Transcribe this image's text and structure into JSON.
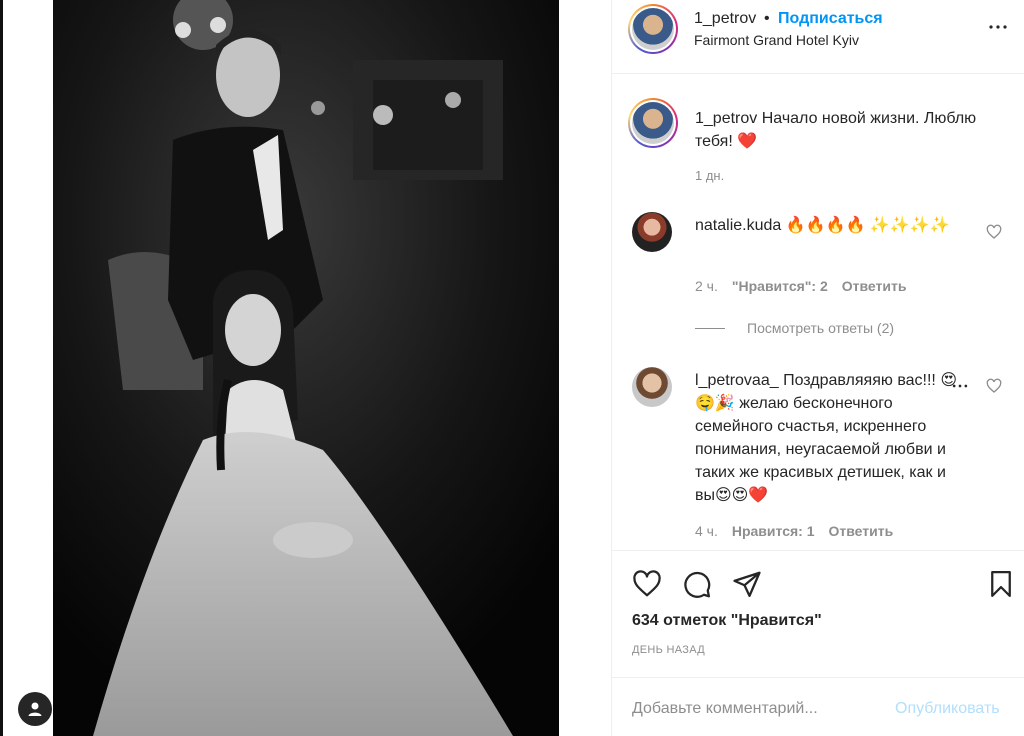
{
  "post": {
    "username": "1_petrov",
    "separator": "•",
    "follow_label": "Подписаться",
    "location": "Fairmont Grand Hotel Kyiv",
    "caption": "Начало новой жизни. Люблю тебя!",
    "caption_emoji": "❤️",
    "caption_time": "1 дн."
  },
  "comments": [
    {
      "username": "natalie.kuda",
      "text": "🔥🔥🔥🔥 ✨✨✨✨",
      "time": "2 ч.",
      "likes": "\"Нравится\": 2",
      "reply": "Ответить"
    },
    {
      "username": "l_petrovaa_",
      "text": "Поздравляяяю вас!!! 😍🤤🎉 желаю бесконечного семейного счастья, искреннего понимания, неугасаемой любви и таких же красивых детишек, как и вы😍😍❤️",
      "time": "4 ч.",
      "likes": "Нравится: 1",
      "reply": "Ответить"
    }
  ],
  "view_replies": "Посмотреть ответы (2)",
  "actions": {
    "like_icon": "heart-icon",
    "comment_icon": "comment-icon",
    "share_icon": "share-icon",
    "save_icon": "bookmark-icon"
  },
  "likes": {
    "count": "634",
    "label": "отметок \"Нравится\""
  },
  "posted_ago": "ДЕНЬ НАЗАД",
  "comment_box": {
    "placeholder": "Добавьте комментарий...",
    "publish_label": "Опубликовать"
  },
  "colors": {
    "accent": "#0095f6",
    "publish_disabled": "#b2dffc",
    "muted": "#8e8e8e",
    "heart_red": "#ed4956"
  }
}
